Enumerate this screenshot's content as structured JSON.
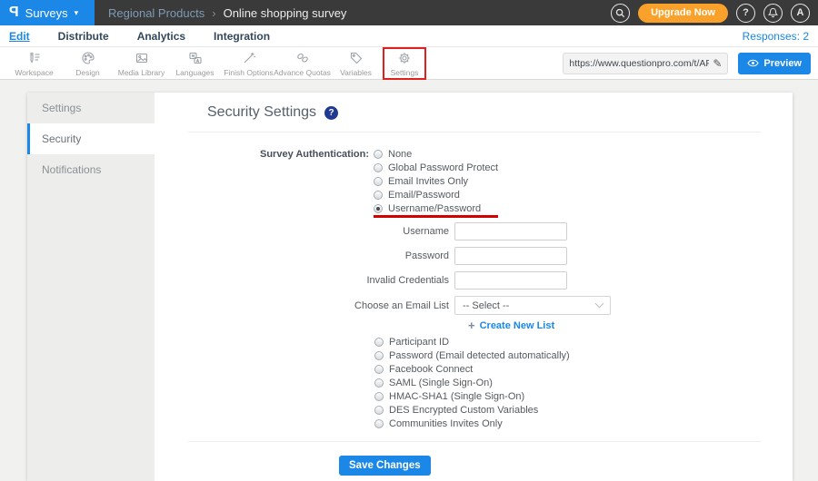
{
  "topbar": {
    "logo_glyph": "P",
    "product": "Surveys",
    "caret": "▾",
    "breadcrumb": {
      "parent": "Regional Products",
      "separator": "›",
      "current": "Online shopping survey"
    },
    "upgrade_label": "Upgrade Now",
    "help_glyph": "?",
    "avatar_letter": "A"
  },
  "subnav": {
    "items": [
      "Edit",
      "Distribute",
      "Analytics",
      "Integration"
    ],
    "active": "Edit",
    "responses": "Responses: 2"
  },
  "toolbar": {
    "items": [
      "Workspace",
      "Design",
      "Media Library",
      "Languages",
      "Finish Options",
      "Advance Quotas",
      "Variables",
      "Settings"
    ],
    "highlighted": "Settings",
    "url_value": "https://www.questionpro.com/t/APNrfZ",
    "pencil_glyph": "✎",
    "preview_label": "Preview"
  },
  "sidebar": {
    "items": [
      "Settings",
      "Security",
      "Notifications"
    ],
    "active": "Security"
  },
  "content": {
    "title": "Security Settings",
    "help_glyph": "?",
    "auth_label": "Survey Authentication:",
    "auth_options": [
      "None",
      "Global Password Protect",
      "Email Invites Only",
      "Email/Password",
      "Username/Password"
    ],
    "selected_option": "Username/Password",
    "fields": [
      {
        "label": "Username",
        "value": ""
      },
      {
        "label": "Password",
        "value": ""
      },
      {
        "label": "Invalid Credentials",
        "value": ""
      }
    ],
    "email_list_label": "Choose an Email List",
    "email_list_value": "-- Select --",
    "create_link_plus": "+",
    "create_link": "Create New List",
    "more_options": [
      "Participant ID",
      "Password (Email detected automatically)",
      "Facebook Connect",
      "SAML (Single Sign-On)",
      "HMAC-SHA1 (Single Sign-On)",
      "DES Encrypted Custom Variables",
      "Communities Invites Only"
    ],
    "save_label": "Save Changes"
  },
  "colors": {
    "accent_blue": "#1b87e6",
    "topbar_dark": "#3a3a3a",
    "upgrade_orange": "#f9a12b",
    "annotation_red": "#e01f1f",
    "underline_red": "#d40000",
    "help_badge_blue": "#1f3a93"
  }
}
